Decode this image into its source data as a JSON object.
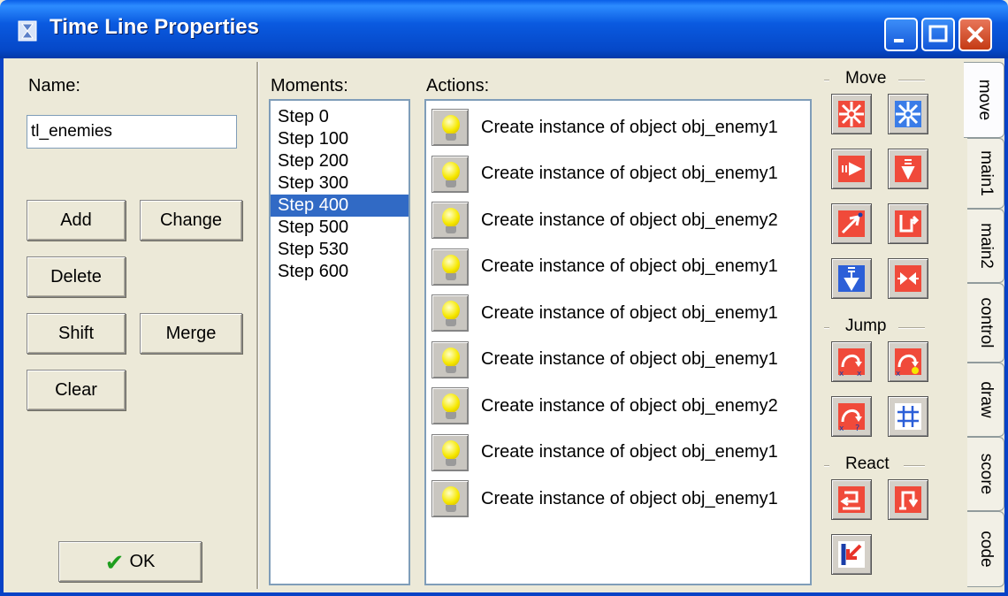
{
  "window": {
    "title": "Time Line Properties"
  },
  "left": {
    "name_label": "Name:",
    "name_value": "tl_enemies",
    "buttons": {
      "add": "Add",
      "change": "Change",
      "delete": "Delete",
      "shift": "Shift",
      "merge": "Merge",
      "clear": "Clear",
      "ok": "OK"
    }
  },
  "moments": {
    "label": "Moments:",
    "items": [
      "Step 0",
      "Step 100",
      "Step 200",
      "Step 300",
      "Step 400",
      "Step 500",
      "Step 530",
      "Step 600"
    ],
    "selected": "Step 400"
  },
  "actions": {
    "label": "Actions:",
    "items": [
      "Create instance of object obj_enemy1",
      "Create instance of object obj_enemy1",
      "Create instance of object obj_enemy2",
      "Create instance of object obj_enemy1",
      "Create instance of object obj_enemy1",
      "Create instance of object obj_enemy1",
      "Create instance of object obj_enemy2",
      "Create instance of object obj_enemy1",
      "Create instance of object obj_enemy1"
    ]
  },
  "palette": {
    "groups": {
      "move": "Move",
      "jump": "Jump",
      "react": "React"
    }
  },
  "tabs": [
    "move",
    "main1",
    "main2",
    "control",
    "draw",
    "score",
    "code"
  ],
  "active_tab": "move",
  "colors": {
    "titlebar": "#0A5AE0",
    "selection": "#316AC5",
    "action_red": "#E8342A",
    "action_blue": "#2C5FD8"
  }
}
